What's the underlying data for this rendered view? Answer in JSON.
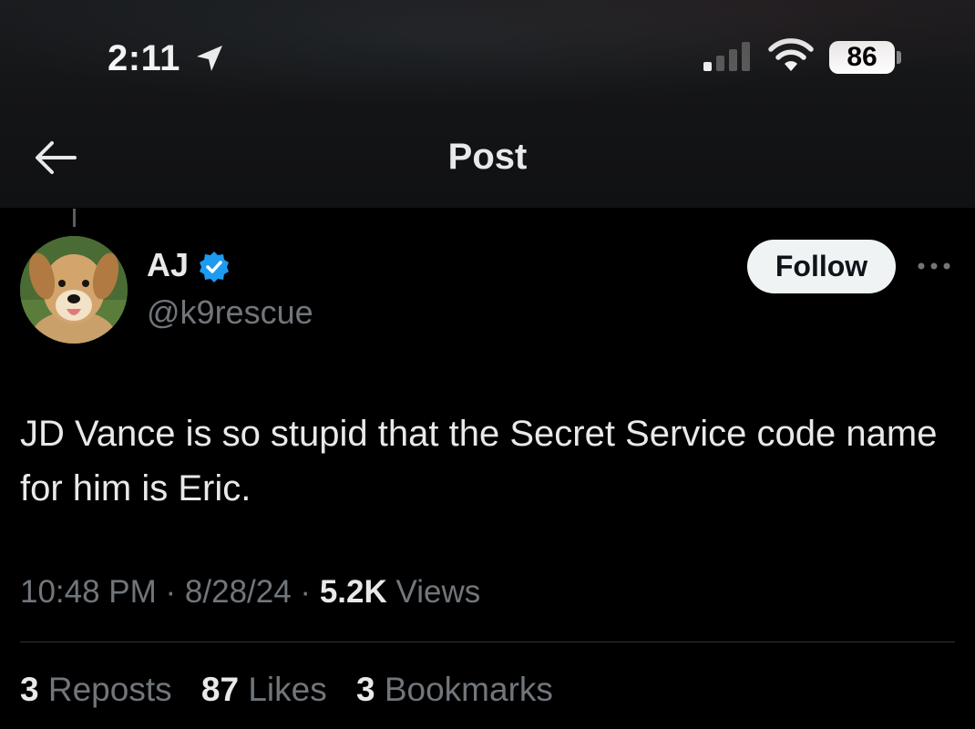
{
  "status_bar": {
    "time": "2:11",
    "battery": "86",
    "icons": [
      "location-arrow-icon",
      "cellular-signal-icon",
      "wifi-icon",
      "battery-icon"
    ]
  },
  "header": {
    "title": "Post",
    "back_icon": "back-arrow-icon"
  },
  "post": {
    "author": {
      "name": "AJ",
      "handle": "@k9rescue",
      "verified": true,
      "verified_color": "#1d9bf0",
      "avatar": "dog-avatar"
    },
    "follow_label": "Follow",
    "more_icon": "more-options-icon",
    "text": "JD Vance is so stupid that the Secret Service code name for him is Eric.",
    "time": "10:48 PM",
    "date": "8/28/24",
    "separator": " · ",
    "views_count": "5.2K",
    "views_label": "Views",
    "stats": {
      "reposts_count": "3",
      "reposts_label": "Reposts",
      "likes_count": "87",
      "likes_label": "Likes",
      "bookmarks_count": "3",
      "bookmarks_label": "Bookmarks"
    }
  },
  "colors": {
    "background": "#000000",
    "text_primary": "#e7e9ea",
    "text_secondary": "#71767b",
    "follow_button_bg": "#eff3f4",
    "verified": "#1d9bf0",
    "divider": "#2f3336"
  }
}
